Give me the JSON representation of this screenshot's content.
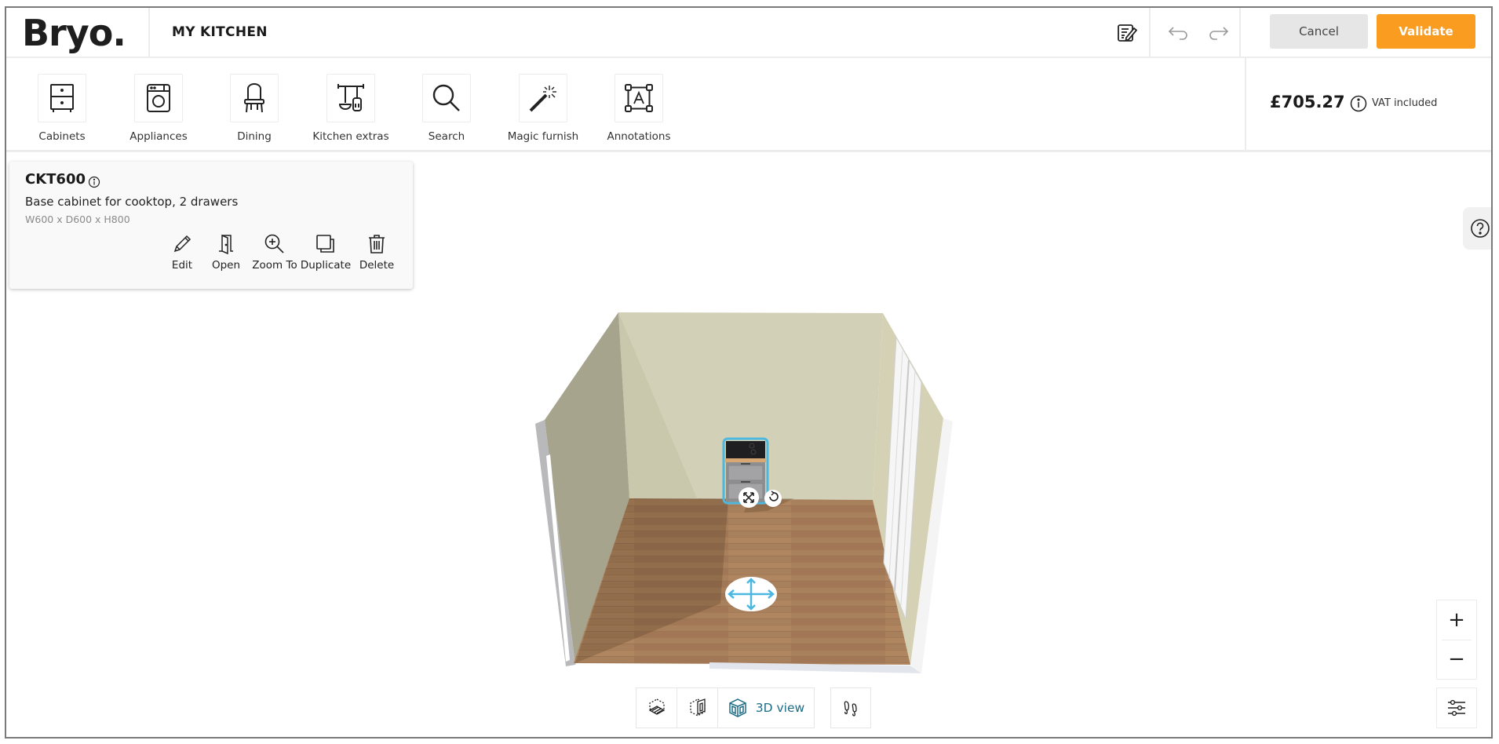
{
  "header": {
    "logo": "Bryo.",
    "project_title": "MY KITCHEN",
    "icons": [
      "notes-edit-icon",
      "undo-icon",
      "redo-icon"
    ],
    "cancel_label": "Cancel",
    "validate_label": "Validate",
    "accent_color": "#f99c1f"
  },
  "toolbar": {
    "tools": [
      {
        "label": "Cabinets",
        "icon": "cabinet-icon"
      },
      {
        "label": "Appliances",
        "icon": "washing-machine-icon"
      },
      {
        "label": "Dining",
        "icon": "chair-icon"
      },
      {
        "label": "Kitchen extras",
        "icon": "utensils-rail-icon"
      },
      {
        "label": "Search",
        "icon": "search-icon"
      },
      {
        "label": "Magic furnish",
        "icon": "magic-wand-icon"
      },
      {
        "label": "Annotations",
        "icon": "annotation-icon"
      }
    ],
    "price": "£705.27",
    "vat_label": "VAT included"
  },
  "item_panel": {
    "code": "CKT600",
    "description": "Base cabinet for cooktop, 2 drawers",
    "dimensions": "W600 x D600 x H800",
    "actions": [
      {
        "label": "Edit",
        "icon": "pencil-icon"
      },
      {
        "label": "Open",
        "icon": "door-open-icon"
      },
      {
        "label": "Zoom To",
        "icon": "zoom-in-icon"
      },
      {
        "label": "Duplicate",
        "icon": "duplicate-icon"
      },
      {
        "label": "Delete",
        "icon": "trash-icon"
      }
    ]
  },
  "view_controls": {
    "modes": [
      {
        "name": "floor-plan-view",
        "icon": "floor-plan-icon"
      },
      {
        "name": "wall-view",
        "icon": "wall-elevation-icon"
      },
      {
        "name": "3d-view",
        "icon": "3d-room-icon",
        "label": "3D view",
        "active": true
      }
    ],
    "walk_icon": "footprints-icon",
    "active_color": "#1d6c86"
  },
  "zoom_controls": {
    "plus": "+",
    "minus": "−"
  },
  "scene": {
    "selection_color": "#4cb8e0"
  }
}
